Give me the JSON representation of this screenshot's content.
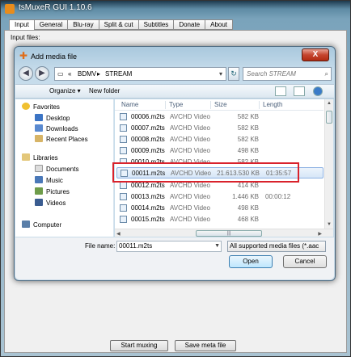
{
  "main": {
    "title": "tsMuxeR GUI 1.10.6",
    "tabs": [
      "Input",
      "General",
      "Blu-ray",
      "Split & cut",
      "Subtitles",
      "Donate",
      "About"
    ],
    "input_files_label": "Input files:",
    "start_button": "Start muxing",
    "save_meta_button": "Save meta file"
  },
  "dialog": {
    "title": "Add media file",
    "close_glyph": "X",
    "address": {
      "prefix": "«",
      "part1": "BDMV",
      "separator": "▸",
      "part2": "STREAM"
    },
    "search_placeholder": "Search STREAM",
    "toolbar": {
      "organize": "Organize ▾",
      "new_folder": "New folder"
    },
    "nav": {
      "favorites": "Favorites",
      "desktop": "Desktop",
      "downloads": "Downloads",
      "recent": "Recent Places",
      "libraries": "Libraries",
      "documents": "Documents",
      "music": "Music",
      "pictures": "Pictures",
      "videos": "Videos",
      "computer": "Computer"
    },
    "columns": {
      "name": "Name",
      "type": "Type",
      "size": "Size",
      "length": "Length"
    },
    "files": [
      {
        "name": "00006.m2ts",
        "type": "AVCHD Video",
        "size": "582 KB",
        "length": ""
      },
      {
        "name": "00007.m2ts",
        "type": "AVCHD Video",
        "size": "582 KB",
        "length": ""
      },
      {
        "name": "00008.m2ts",
        "type": "AVCHD Video",
        "size": "582 KB",
        "length": ""
      },
      {
        "name": "00009.m2ts",
        "type": "AVCHD Video",
        "size": "498 KB",
        "length": ""
      },
      {
        "name": "00010.m2ts",
        "type": "AVCHD Video",
        "size": "582 KB",
        "length": ""
      },
      {
        "name": "00011.m2ts",
        "type": "AVCHD Video",
        "size": "21.613.530 KB",
        "length": "01:35:57"
      },
      {
        "name": "00012.m2ts",
        "type": "AVCHD Video",
        "size": "414 KB",
        "length": ""
      },
      {
        "name": "00013.m2ts",
        "type": "AVCHD Video",
        "size": "1.446 KB",
        "length": "00:00:12"
      },
      {
        "name": "00014.m2ts",
        "type": "AVCHD Video",
        "size": "498 KB",
        "length": ""
      },
      {
        "name": "00015.m2ts",
        "type": "AVCHD Video",
        "size": "468 KB",
        "length": ""
      }
    ],
    "filename_label": "File name:",
    "filename_value": "00011.m2ts",
    "filter_value": "All supported media files (*.aac",
    "open_button": "Open",
    "cancel_button": "Cancel",
    "highlight_color": "#d9222c"
  }
}
